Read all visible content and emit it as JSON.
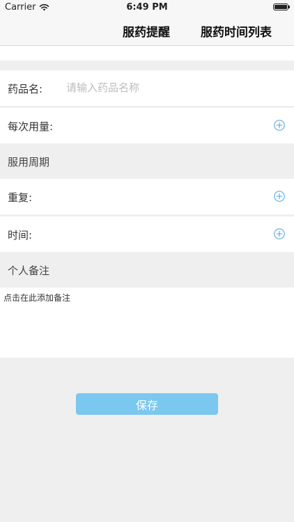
{
  "status_bar": {
    "carrier": "Carrier",
    "time": "6:49 PM"
  },
  "nav": {
    "tabs": [
      {
        "label": "服药提醒"
      },
      {
        "label": "服药时间列表"
      }
    ]
  },
  "form": {
    "drug_name": {
      "label": "药品名:",
      "value": "",
      "placeholder": "请输入药品名称"
    },
    "dosage": {
      "label": "每次用量:"
    },
    "cycle_section": {
      "title": "服用周期"
    },
    "repeat": {
      "label": "重复:"
    },
    "time": {
      "label": "时间:"
    },
    "note_section": {
      "title": "个人备注"
    },
    "note": {
      "value": "",
      "placeholder": "点击在此添加备注"
    },
    "save_label": "保存"
  },
  "colors": {
    "accent": "#7ac7ef",
    "icon": "#5aa9df",
    "background": "#efefef"
  },
  "icons": {
    "add": "plus-circle-icon",
    "wifi": "wifi-icon",
    "battery": "battery-icon"
  }
}
